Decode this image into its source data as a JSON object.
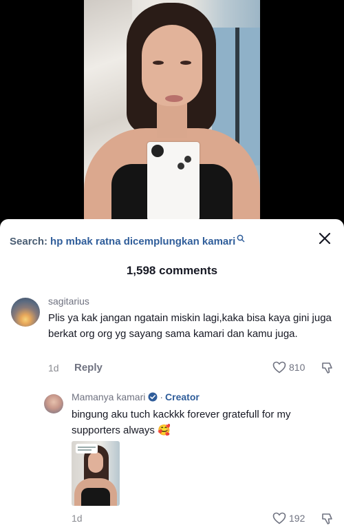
{
  "search": {
    "prefix": "Search:",
    "query": "hp mbak ratna dicemplungkan kamari"
  },
  "comments_header": {
    "count_label": "1,598 comments"
  },
  "comments": [
    {
      "username": "sagitarius",
      "text": "Plis ya kak jangan ngatain miskin lagi,kaka bisa kaya gini juga berkat org org yg sayang sama kamari dan kamu juga.",
      "time": "1d",
      "reply_label": "Reply",
      "likes": "810"
    }
  ],
  "reply": {
    "username": "Mamanya kamari",
    "badge": "Creator",
    "text": "bingung aku tuch kackkk forever gratefull for my supporters always 🥰",
    "time": "1d",
    "likes": "192"
  },
  "colors": {
    "accent": "#2f5d9a",
    "verified": "#2f5d9a",
    "muted": "#6f7280"
  },
  "icons": [
    "search-icon",
    "close-icon",
    "heart-icon",
    "dislike-icon",
    "verified-icon"
  ]
}
